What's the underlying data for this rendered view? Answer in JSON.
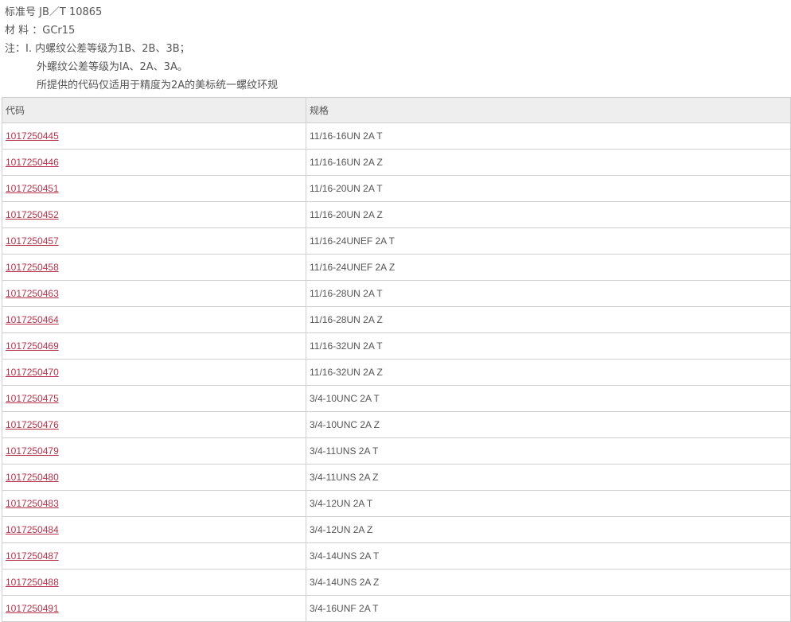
{
  "info": {
    "standard": "标准号 JB／T 10865",
    "material": "材  料 ：GCr15",
    "note_line1": "注：I. 内螺纹公差等级为1B、2B、3B；",
    "note_line2": "外螺纹公差等级为lA、2A、3A。",
    "note_line3": "所提供的代码仅适用于精度为2A的美标统一螺纹环规"
  },
  "table": {
    "headers": [
      "代码",
      "规格"
    ],
    "rows": [
      {
        "code": "1017250445",
        "spec": "11/16-16UN 2A T"
      },
      {
        "code": "1017250446",
        "spec": "11/16-16UN 2A Z"
      },
      {
        "code": "1017250451",
        "spec": "11/16-20UN 2A T"
      },
      {
        "code": "1017250452",
        "spec": "11/16-20UN 2A Z"
      },
      {
        "code": "1017250457",
        "spec": "11/16-24UNEF 2A T"
      },
      {
        "code": "1017250458",
        "spec": "11/16-24UNEF 2A Z"
      },
      {
        "code": "1017250463",
        "spec": "11/16-28UN 2A T"
      },
      {
        "code": "1017250464",
        "spec": "11/16-28UN 2A Z"
      },
      {
        "code": "1017250469",
        "spec": "11/16-32UN 2A T"
      },
      {
        "code": "1017250470",
        "spec": "11/16-32UN 2A Z"
      },
      {
        "code": "1017250475",
        "spec": "3/4-10UNC 2A T"
      },
      {
        "code": "1017250476",
        "spec": "3/4-10UNC 2A Z"
      },
      {
        "code": "1017250479",
        "spec": "3/4-11UNS 2A T"
      },
      {
        "code": "1017250480",
        "spec": "3/4-11UNS 2A Z"
      },
      {
        "code": "1017250483",
        "spec": "3/4-12UN 2A T"
      },
      {
        "code": "1017250484",
        "spec": "3/4-12UN 2A Z"
      },
      {
        "code": "1017250487",
        "spec": "3/4-14UNS 2A T"
      },
      {
        "code": "1017250488",
        "spec": "3/4-14UNS 2A Z"
      },
      {
        "code": "1017250491",
        "spec": "3/4-16UNF 2A T"
      }
    ]
  },
  "colors": {
    "link": "#b5334b",
    "text": "#555555",
    "header_bg": "#eeeeee",
    "border": "#cfcfcf"
  }
}
